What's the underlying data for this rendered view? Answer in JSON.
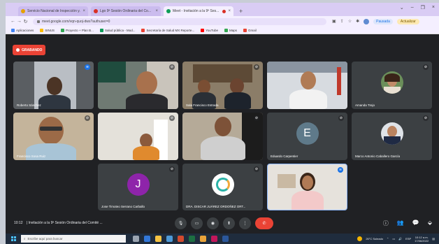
{
  "browser": {
    "tabs": [
      {
        "title": "Servicio Nacional de Inspección y...",
        "active": false,
        "fav_color": "#e5a100"
      },
      {
        "title": "Lgo 9ª Sesión Ordinaria del Co...",
        "active": false,
        "fav_color": "#d93025"
      },
      {
        "title": "Meet - Invitación a la 9ª Ses...",
        "active": true,
        "fav_color": "#0f9d58"
      }
    ],
    "tab_close": "×",
    "new_tab": "+",
    "window_controls": [
      "⌄",
      "–",
      "❐",
      "×"
    ],
    "url": "meet.google.com/vqn-quoj-dws?authuser=0",
    "incognito_label": "Pausada",
    "update_label": "Actualizar",
    "bookmarks": [
      {
        "label": "Aplicaciones",
        "color": "#4285f4"
      },
      {
        "label": "SINUS",
        "color": "#fbbc04"
      },
      {
        "label": "Proyecto + Plan B...",
        "color": "#34a853"
      },
      {
        "label": "Salud pública - Mod...",
        "color": "#0f9d58"
      },
      {
        "label": "Secretaría de Salud MX Reporte...",
        "color": "#ea4335"
      },
      {
        "label": "YouTube",
        "color": "#ff0000"
      },
      {
        "label": "Maps",
        "color": "#34a853"
      },
      {
        "label": "Gmail",
        "color": "#ea4335"
      }
    ]
  },
  "meet": {
    "recording_label": "GRABANDO",
    "participants": [
      {
        "name": "Roberto Sánchez",
        "kind": "video",
        "mic_active": true
      },
      {
        "name": "",
        "kind": "video",
        "mic_active": false
      },
      {
        "name": "Sala Francisco Estrada",
        "kind": "video",
        "mic_active": false
      },
      {
        "name": "",
        "kind": "video",
        "mic_active": false
      },
      {
        "name": "Amanda Trejo",
        "kind": "photo",
        "mic_active": false
      },
      {
        "name": "Francisco Sosa Ruiz",
        "kind": "video",
        "mic_active": false
      },
      {
        "name": "",
        "kind": "video",
        "mic_active": false
      },
      {
        "name": "",
        "kind": "video",
        "mic_active": false
      },
      {
        "name": "Eduardo Carpentier",
        "kind": "letter",
        "letter": "E",
        "color": "#5f7a8a",
        "mic_active": false
      },
      {
        "name": "Marco Antonio Caballero García",
        "kind": "photo",
        "mic_active": false
      },
      {
        "name": "Jose Timoteo Serrano Carballo",
        "kind": "letter",
        "letter": "J",
        "color": "#8e24aa",
        "mic_active": false
      },
      {
        "name": "DRA. DISCAR JUÁREZ ORDOÑEZ ORT...",
        "kind": "logo",
        "mic_active": false
      },
      {
        "name": "",
        "kind": "video",
        "mic_active": true
      }
    ],
    "meeting_time": "10:12",
    "meeting_title": "Invitación a la 9ª Sesión Ordinaria del Comité ...",
    "controls": [
      "mic-icon",
      "camera-icon",
      "captions-icon",
      "present-icon",
      "more-icon",
      "end-call-icon"
    ],
    "control_glyphs": [
      "🎙",
      "▭",
      "◉",
      "⬆",
      "⋮",
      "✆"
    ],
    "right_controls": [
      "info-icon",
      "people-icon",
      "chat-icon",
      "activities-icon"
    ],
    "right_glyphs": [
      "ⓘ",
      "👥",
      "💬",
      "⬙"
    ]
  },
  "taskbar": {
    "search_placeholder": "Escribe aquí para buscar",
    "weather": "26°C Soleado",
    "time": "10:12 a.m.",
    "date": "17/06/2022",
    "tray_glyphs": [
      "⌃",
      "▭",
      "🔊",
      "ESP"
    ]
  }
}
